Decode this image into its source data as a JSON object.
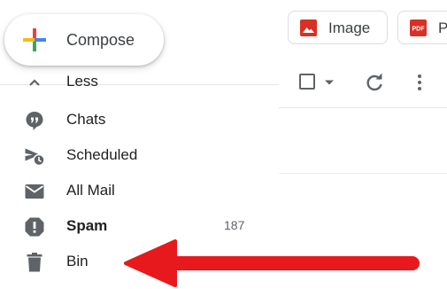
{
  "compose": {
    "label": "Compose"
  },
  "chips": {
    "image": {
      "label": "Image",
      "icon": "image-icon",
      "color": "#d93025"
    },
    "pdf": {
      "label": "P",
      "icon": "pdf-icon",
      "icon_text": "PDF",
      "color": "#d93025"
    }
  },
  "sidebar": {
    "items": [
      {
        "label": "Less",
        "icon": "chevron-up-icon"
      },
      {
        "label": "Chats",
        "icon": "chat-icon"
      },
      {
        "label": "Scheduled",
        "icon": "scheduled-send-icon"
      },
      {
        "label": "All Mail",
        "icon": "mail-icon"
      },
      {
        "label": "Spam",
        "icon": "spam-icon",
        "count": "187",
        "bold": true
      },
      {
        "label": "Bin",
        "icon": "trash-icon"
      }
    ]
  },
  "toolbar": {
    "icons": [
      "select-checkbox",
      "caret-down-icon",
      "refresh-icon",
      "more-vert-icon"
    ]
  },
  "annotation": {
    "type": "arrow",
    "color": "#e8191c",
    "points_to": "Bin"
  },
  "colors": {
    "icon_gray": "#5f6368",
    "text": "#202124",
    "divider": "#e6e6e6"
  }
}
